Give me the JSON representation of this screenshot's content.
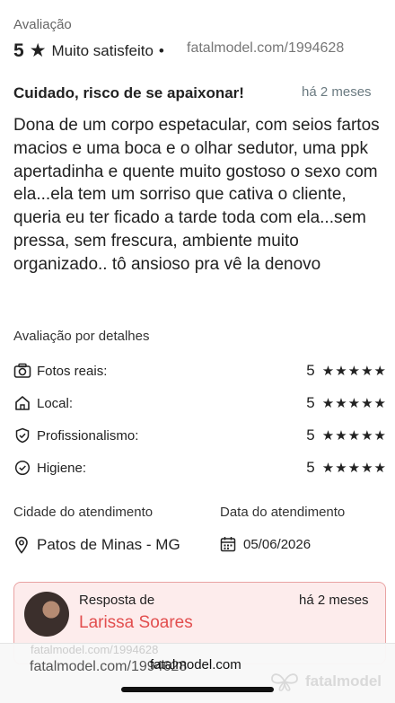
{
  "review": {
    "section_label": "Avaliação",
    "score": "5",
    "star": "★",
    "satisfaction": "Muito satisfeito",
    "dot": "•",
    "watermark": "fatalmodel.com/1994628",
    "title": "Cuidado, risco de se apaixonar!",
    "time_ago": "há 2 meses",
    "text": "Dona de um corpo espetacular, com seios fartos macios e uma boca e o olhar sedutor, uma ppk apertadinha e quente muito gostoso o sexo com ela...ela tem um sorriso que cativa o cliente, queria eu ter ficado a tarde toda com ela...sem pressa, sem frescura, ambiente muito organizado.. tô ansioso pra vê la denovo"
  },
  "details": {
    "heading": "Avaliação por detalhes",
    "items": [
      {
        "icon": "camera-icon",
        "label": "Fotos reais:",
        "score": "5",
        "stars": "★★★★★"
      },
      {
        "icon": "home-icon",
        "label": "Local:",
        "score": "5",
        "stars": "★★★★★"
      },
      {
        "icon": "shield-check-icon",
        "label": "Profissionalismo:",
        "score": "5",
        "stars": "★★★★★"
      },
      {
        "icon": "check-circle-icon",
        "label": "Higiene:",
        "score": "5",
        "stars": "★★★★★"
      }
    ]
  },
  "service": {
    "city_label": "Cidade do atendimento",
    "city": "Patos de Minas - MG",
    "date_label": "Data do atendimento",
    "date": "05/06/2026"
  },
  "response": {
    "label": "Resposta de",
    "name": "Larissa Soares",
    "time_ago": "há 2 meses"
  },
  "footer": {
    "faded_watermark": "fatalmodel.com/1994628",
    "watermark_left": "fatalmodel.com/1994628",
    "watermark_center": "fatalmodel.com",
    "brand": "fatalmodel"
  },
  "colors": {
    "accent_red": "#e24e4e",
    "response_bg": "#fdecec",
    "response_border": "#e9a3a3"
  }
}
